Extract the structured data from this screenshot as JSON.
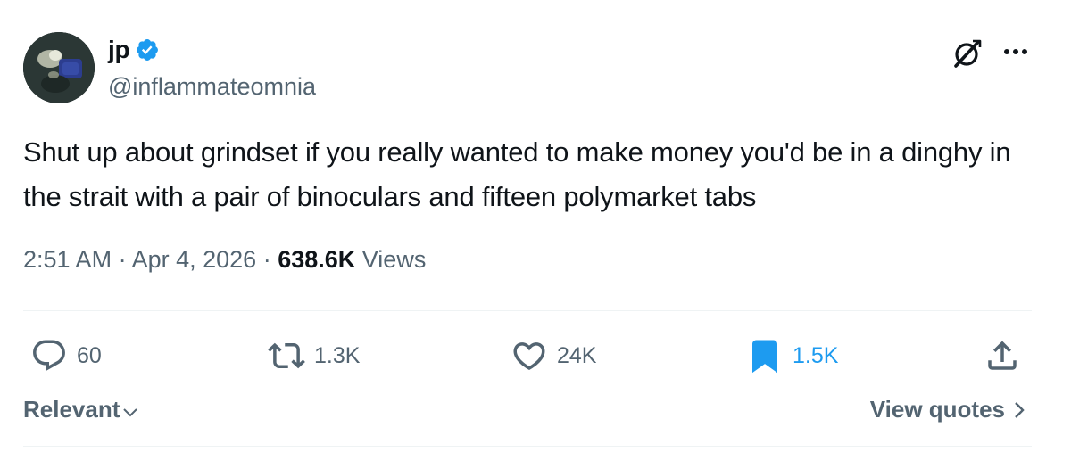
{
  "author": {
    "display_name": "jp",
    "handle": "@inflammateomnia",
    "verified": true,
    "verified_color": "#1d9bf0"
  },
  "tweet": {
    "text": "Shut up about grindset if you really wanted to make money you'd be in a dinghy in the strait with a pair of binoculars and fifteen polymarket tabs",
    "time": "2:51 AM",
    "date": "Apr 4, 2026",
    "views_count": "638.6K",
    "views_label": "Views"
  },
  "actions": {
    "reply": {
      "icon": "reply-icon",
      "count": "60"
    },
    "retweet": {
      "icon": "retweet-icon",
      "count": "1.3K"
    },
    "like": {
      "icon": "like-icon",
      "count": "24K"
    },
    "bookmark": {
      "icon": "bookmark-icon",
      "count": "1.5K",
      "active": true,
      "active_color": "#1d9bf0"
    },
    "share": {
      "icon": "share-icon"
    }
  },
  "footer": {
    "sort_label": "Relevant",
    "view_quotes_label": "View quotes"
  },
  "colors": {
    "text": "#0f1419",
    "secondary": "#536471",
    "accent": "#1d9bf0"
  }
}
